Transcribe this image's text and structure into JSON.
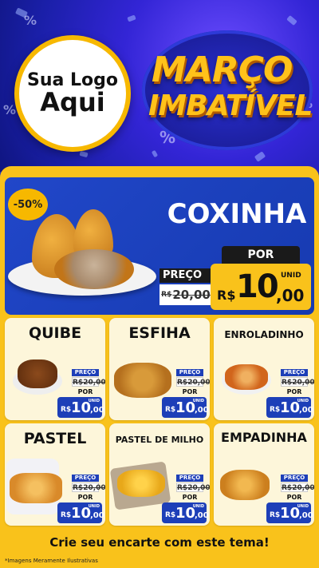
{
  "header": {
    "logo_line1": "Sua Logo",
    "logo_line2": "Aqui",
    "title_line1": "MARÇO",
    "title_line2": "IMBATÍVEL",
    "colors": {
      "bg": "#1b2fb8",
      "accent": "#f9c21b",
      "title": "#ffc21a"
    }
  },
  "featured": {
    "discount": "-50%",
    "name": "COXINHA",
    "preco_label": "PREÇO",
    "old_currency": "R$",
    "old_price": "20,00",
    "por_label": "POR",
    "currency": "R$",
    "price_int": "10",
    "price_cents": ",00",
    "unit": "UNID"
  },
  "products": [
    {
      "name": "QUIBE",
      "preco_label": "PREÇO",
      "old_price": "R$20,00",
      "por_label": "POR",
      "currency": "R$",
      "price_int": "10",
      "price_cents": ",00",
      "unit": "UNID"
    },
    {
      "name": "ESFIHA",
      "preco_label": "PREÇO",
      "old_price": "R$20,00",
      "por_label": "POR",
      "currency": "R$",
      "price_int": "10",
      "price_cents": ",00",
      "unit": "UNID"
    },
    {
      "name": "ENROLADINHO",
      "preco_label": "PREÇO",
      "old_price": "R$20,00",
      "por_label": "POR",
      "currency": "R$",
      "price_int": "10",
      "price_cents": ",00",
      "unit": "UNID"
    },
    {
      "name": "PASTEL",
      "preco_label": "PREÇO",
      "old_price": "R$20,00",
      "por_label": "POR",
      "currency": "R$",
      "price_int": "10",
      "price_cents": ",00",
      "unit": "UNID"
    },
    {
      "name": "PASTEL DE MILHO",
      "preco_label": "PREÇO",
      "old_price": "R$20,00",
      "por_label": "POR",
      "currency": "R$",
      "price_int": "10",
      "price_cents": ",00",
      "unit": "UNID"
    },
    {
      "name": "EMPADINHA",
      "preco_label": "PREÇO",
      "old_price": "R$20,00",
      "por_label": "POR",
      "currency": "R$",
      "price_int": "10",
      "price_cents": ",00",
      "unit": "UNID"
    }
  ],
  "footer": {
    "cta": "Crie seu encarte com este tema!",
    "disclaimer": "*Imagens Meramente Ilustrativas"
  }
}
